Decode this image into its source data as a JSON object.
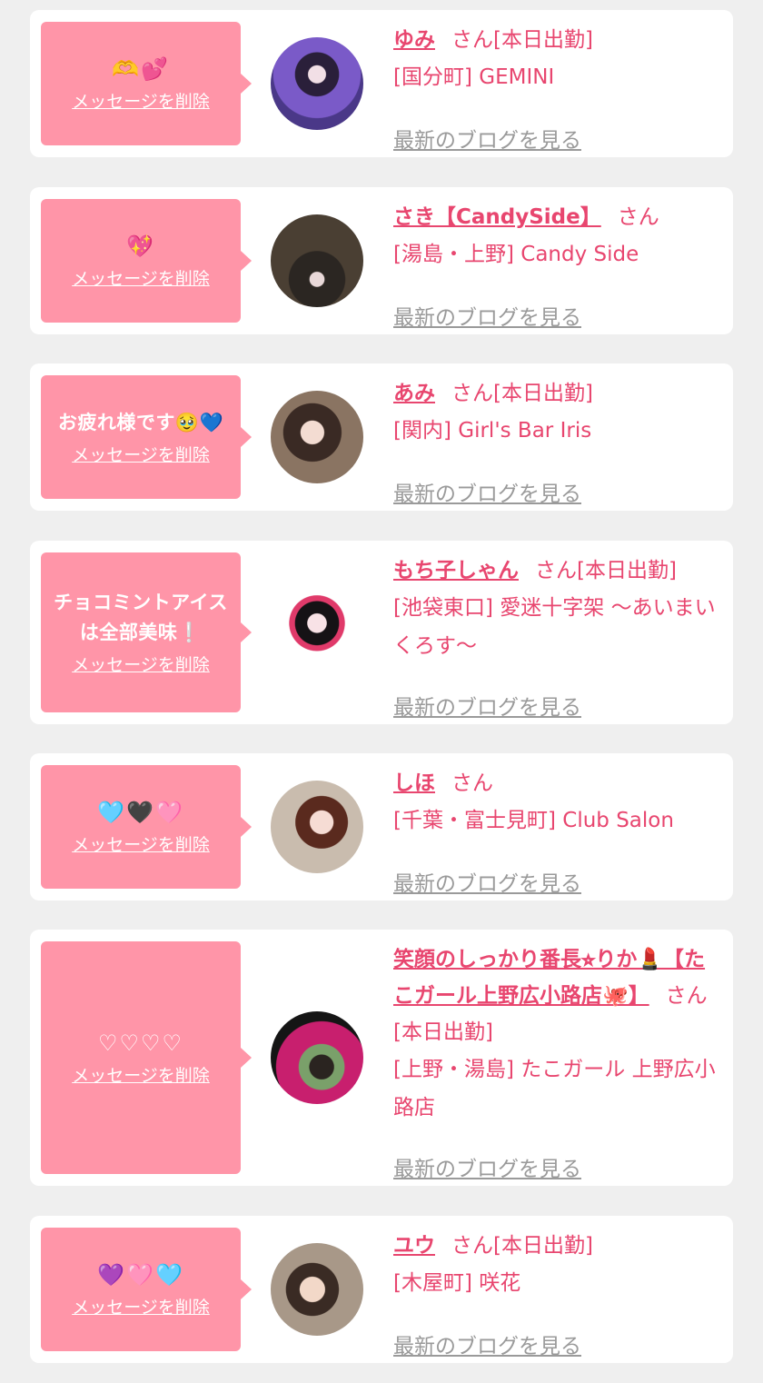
{
  "delete_label": "メッセージを削除",
  "blog_label": "最新のブログを見る",
  "colors": {
    "accent": "#e8466f",
    "bubble": "#ff95a8",
    "muted": "#9a9a9a"
  },
  "cards": [
    {
      "message": "🫶💕",
      "name": "ゆみ",
      "suffix": "さん[本日出勤]",
      "shop": "[国分町] GEMINI"
    },
    {
      "message": "💖",
      "name": "さき【CandySide】",
      "suffix": "さん",
      "shop": "[湯島・上野] Candy Side"
    },
    {
      "message": "お疲れ様です🥹💙",
      "name": "あみ",
      "suffix": "さん[本日出勤]",
      "shop": "[関内] Girl's Bar Iris"
    },
    {
      "message": "チョコミントアイスは全部美味❕",
      "name": "もち子しゃん",
      "suffix": "さん[本日出勤]",
      "shop": "[池袋東口] 愛迷十字架 〜あいまいくろす〜"
    },
    {
      "message": "🩵🖤🩷",
      "name": "しほ",
      "suffix": "さん",
      "shop": "[千葉・富士見町] Club Salon"
    },
    {
      "message": "♡♡♡♡",
      "name": "笑顔のしっかり番長⭐︎りか💄【たこガール上野広小路店🐙】",
      "suffix": "さん[本日出勤]",
      "shop": "[上野・湯島] たこガール 上野広小路店"
    },
    {
      "message": "💜🩷🩵",
      "name": "ユウ",
      "suffix": "さん[本日出勤]",
      "shop": "[木屋町] 咲花"
    }
  ]
}
